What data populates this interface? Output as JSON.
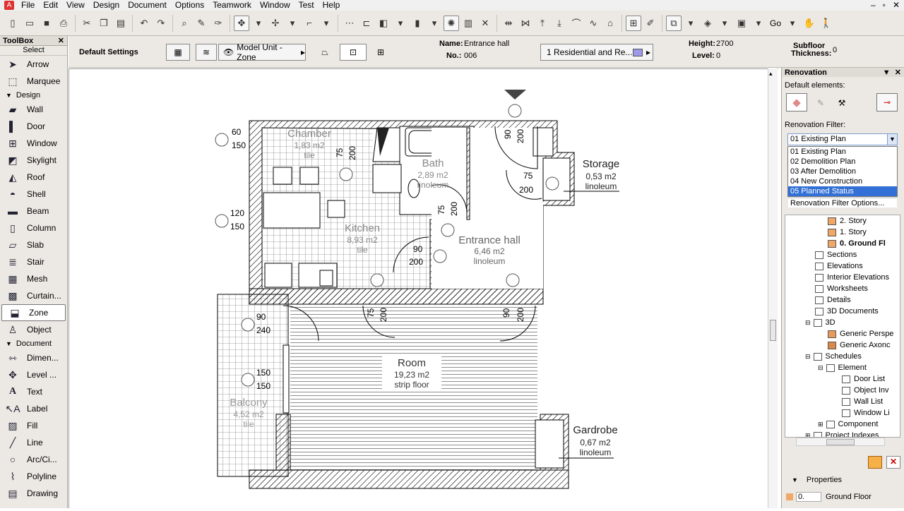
{
  "menu": {
    "items": [
      "File",
      "Edit",
      "View",
      "Design",
      "Document",
      "Options",
      "Teamwork",
      "Window",
      "Test",
      "Help"
    ]
  },
  "toolbar": {
    "go_label": "Go"
  },
  "infobox": {
    "default_settings": "Default Settings",
    "model_unit_label": "Model Unit - Zone",
    "name_label": "Name:",
    "name_value": "Entrance hall",
    "no_label": "No.:",
    "no_value": "006",
    "category": "1  Residential and Re...",
    "height_label": "Height:",
    "height_value": "2700",
    "level_label": "Level:",
    "level_value": "0",
    "subfloor_label": "Subfloor",
    "thickness_label": "Thickness:",
    "subfloor_value": "0"
  },
  "toolbox": {
    "title": "ToolBox",
    "close": "✕",
    "select": "Select",
    "select_tools": [
      "Arrow",
      "Marquee"
    ],
    "design_group": "Design",
    "design_tools": [
      "Wall",
      "Door",
      "Window",
      "Skylight",
      "Roof",
      "Shell",
      "Beam",
      "Column",
      "Slab",
      "Stair",
      "Mesh",
      "Curtain...",
      "Zone",
      "Object"
    ],
    "document_group": "Document",
    "document_tools": [
      "Dimen...",
      "Level ...",
      "Text",
      "Label",
      "Fill",
      "Line",
      "Arc/Ci...",
      "Polyline",
      "Drawing"
    ],
    "active_tool": "Zone"
  },
  "plan": {
    "rooms": [
      {
        "name": "Chamber",
        "area": "1,83 m2",
        "material": "tile"
      },
      {
        "name": "Bath",
        "area": "2,89 m2",
        "material": "linoleum"
      },
      {
        "name": "Storage",
        "area": "0,53 m2",
        "material": "linoleum"
      },
      {
        "name": "Kitchen",
        "area": "8,93 m2",
        "material": "tile"
      },
      {
        "name": "Entrance hall",
        "area": "6,46 m2",
        "material": "linoleum"
      },
      {
        "name": "Room",
        "area": "19,23 m2",
        "material": "strip floor"
      },
      {
        "name": "Balcony",
        "area": "4,52 m2",
        "material": "tile"
      },
      {
        "name": "Gardrobe",
        "area": "0,67 m2",
        "material": "linoleum"
      }
    ],
    "dims": {
      "d60": "60",
      "d150a": "150",
      "d120": "120",
      "d150b": "150",
      "d75a": "75",
      "d200a": "200",
      "d90a": "90",
      "d200b": "200",
      "d75b": "75",
      "d200c": "200",
      "d75c": "75",
      "d200d": "200",
      "d90b": "90",
      "d200e": "200",
      "d75d": "75",
      "d200f": "200",
      "d90c": "90",
      "d200g": "200",
      "d90d": "90",
      "d240": "240",
      "d150c": "150",
      "d150d": "150"
    }
  },
  "renovation": {
    "title": "Renovation",
    "default_elements_label": "Default elements:",
    "filter_label": "Renovation Filter:",
    "selected": "01 Existing Plan",
    "options": [
      "01 Existing Plan",
      "02 Demolition Plan",
      "03 After Demolition",
      "04 New Construction",
      "05 Planned Status"
    ],
    "highlighted": "05 Planned Status",
    "options_link": "Renovation Filter Options..."
  },
  "navigator": {
    "items": [
      {
        "label": "2. Story",
        "bold": false
      },
      {
        "label": "1. Story",
        "bold": false
      },
      {
        "label": "0. Ground Fl",
        "bold": true
      },
      {
        "label": "Sections",
        "bold": false
      },
      {
        "label": "Elevations",
        "bold": false
      },
      {
        "label": "Interior Elevations",
        "bold": false
      },
      {
        "label": "Worksheets",
        "bold": false
      },
      {
        "label": "Details",
        "bold": false
      },
      {
        "label": "3D Documents",
        "bold": false
      },
      {
        "label": "3D",
        "bold": false
      },
      {
        "label": "Generic Perspe",
        "bold": false
      },
      {
        "label": "Generic Axonc",
        "bold": false
      },
      {
        "label": "Schedules",
        "bold": false
      },
      {
        "label": "Element",
        "bold": false
      },
      {
        "label": "Door List",
        "bold": false
      },
      {
        "label": "Object Inv",
        "bold": false
      },
      {
        "label": "Wall List",
        "bold": false
      },
      {
        "label": "Window Li",
        "bold": false
      },
      {
        "label": "Component",
        "bold": false
      },
      {
        "label": "Project Indexes",
        "bold": false
      }
    ],
    "properties_label": "Properties",
    "prop_value": "0.",
    "prop_name": "Ground Floor"
  }
}
